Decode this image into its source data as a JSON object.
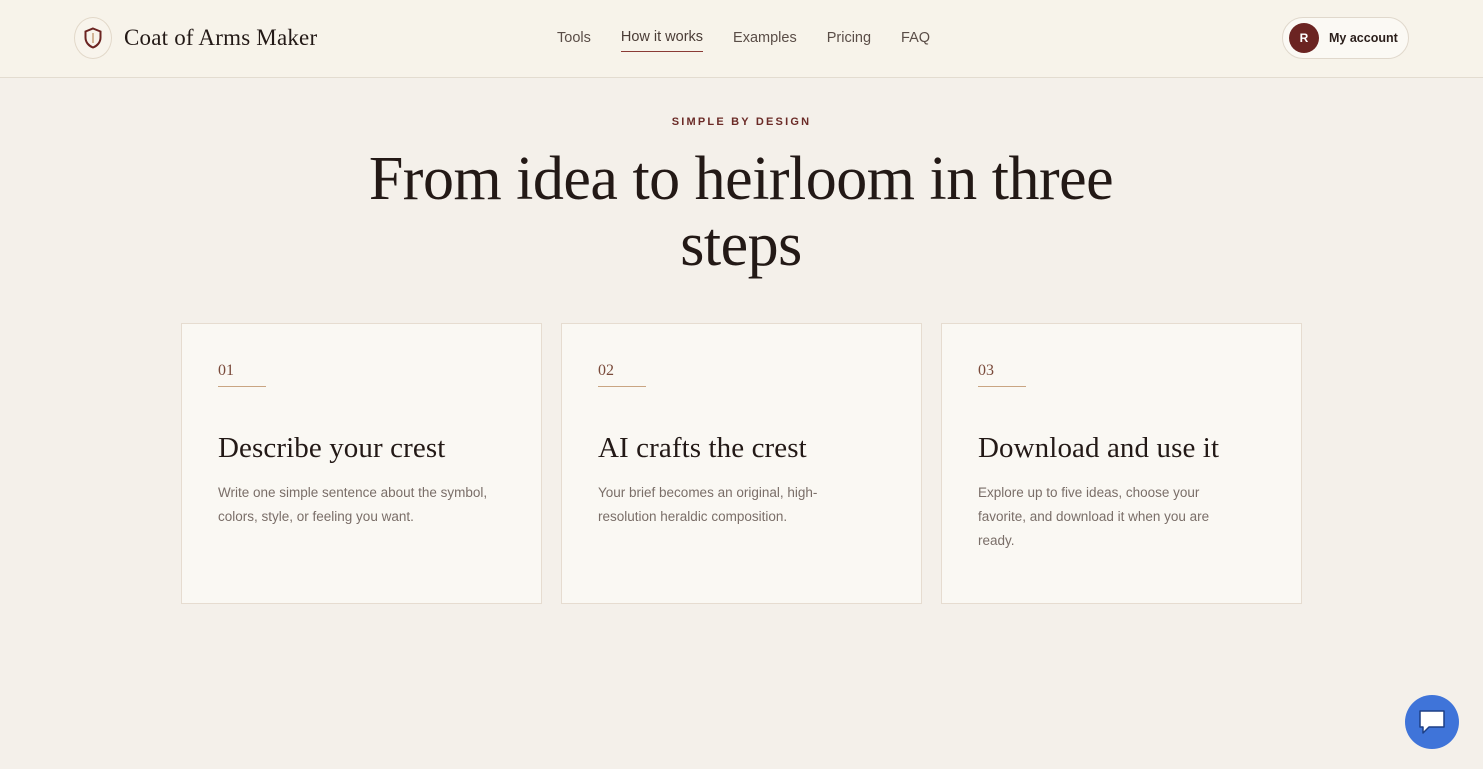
{
  "header": {
    "brand_name": "Coat of Arms Maker",
    "logo_icon": "shield-icon",
    "nav": [
      {
        "label": "Tools",
        "active": false
      },
      {
        "label": "How it works",
        "active": true
      },
      {
        "label": "Examples",
        "active": false
      },
      {
        "label": "Pricing",
        "active": false
      },
      {
        "label": "FAQ",
        "active": false
      }
    ],
    "account": {
      "avatar_initial": "R",
      "label": "My account"
    }
  },
  "hero": {
    "eyebrow": "SIMPLE BY DESIGN",
    "headline": "From idea to heirloom in three steps"
  },
  "steps": [
    {
      "number": "01",
      "title": "Describe your crest",
      "body": "Write one simple sentence about the symbol, colors, style, or feeling you want."
    },
    {
      "number": "02",
      "title": "AI crafts the crest",
      "body": "Your brief becomes an original, high-resolution heraldic composition."
    },
    {
      "number": "03",
      "title": "Download and use it",
      "body": "Explore up to five ideas, choose your favorite, and download it when you are ready."
    }
  ],
  "chat": {
    "icon": "chat-bubble-icon"
  },
  "colors": {
    "accent": "#6b2422",
    "background": "#f4f0ea",
    "chat": "#3f74d9"
  }
}
